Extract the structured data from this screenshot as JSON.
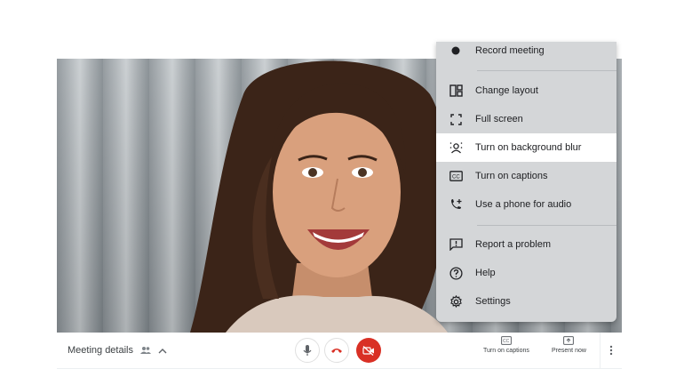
{
  "menu": {
    "items": [
      {
        "label": "Record meeting",
        "icon": "record-icon"
      },
      {
        "label": "Change layout",
        "icon": "layout-icon"
      },
      {
        "label": "Full screen",
        "icon": "fullscreen-icon"
      },
      {
        "label": "Turn on background blur",
        "icon": "background-blur-icon",
        "highlighted": true
      },
      {
        "label": "Turn on captions",
        "icon": "captions-icon"
      },
      {
        "label": "Use a phone for audio",
        "icon": "phone-audio-icon"
      },
      {
        "label": "Report a problem",
        "icon": "report-icon"
      },
      {
        "label": "Help",
        "icon": "help-icon"
      },
      {
        "label": "Settings",
        "icon": "settings-icon"
      }
    ]
  },
  "bottom_bar": {
    "meeting_details_label": "Meeting details",
    "captions_label": "Turn on captions",
    "present_label": "Present now"
  },
  "colors": {
    "hang_up": "#d93025",
    "camera_off_bg": "#d93025",
    "menu_bg": "#d4d6d8",
    "highlight_bg": "#ffffff"
  }
}
